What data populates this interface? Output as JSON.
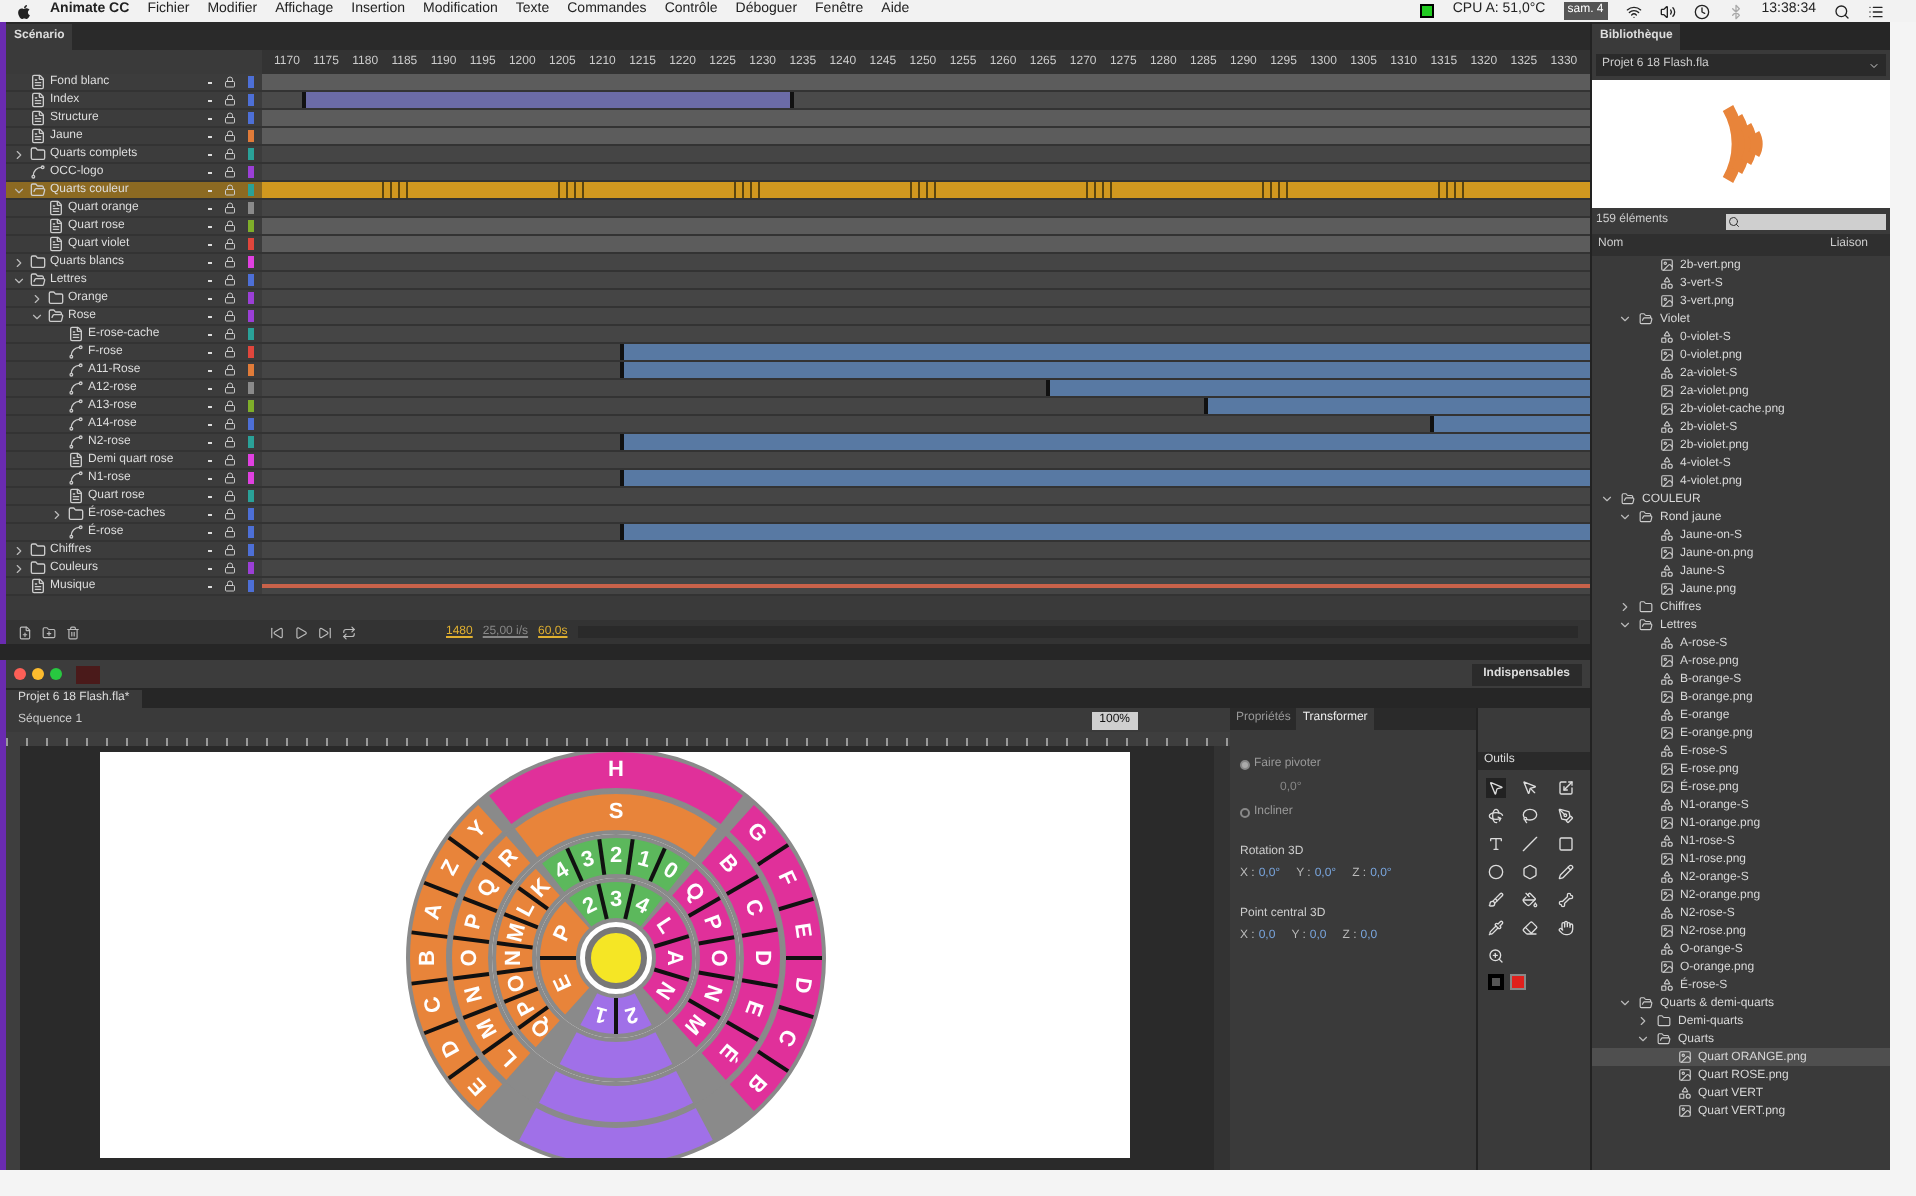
{
  "menubar": {
    "app": "Animate CC",
    "menus": [
      "Fichier",
      "Modifier",
      "Affichage",
      "Insertion",
      "Modification",
      "Texte",
      "Commandes",
      "Contrôle",
      "Déboguer",
      "Fenêtre",
      "Aide"
    ],
    "cpu": "CPU A: 51,0°C",
    "date": "sam. 4",
    "time": "13:38:34"
  },
  "timeline": {
    "tab": "Scénario",
    "frames": [
      "1170",
      "1175",
      "1180",
      "1185",
      "1190",
      "1195",
      "1200",
      "1205",
      "1210",
      "1215",
      "1220",
      "1225",
      "1230",
      "1235",
      "1240",
      "1245",
      "1250",
      "1255",
      "1260",
      "1265",
      "1270",
      "1275",
      "1280",
      "1285",
      "1290",
      "1295",
      "1300",
      "1305",
      "1310",
      "1315",
      "1320",
      "1325",
      "1330"
    ],
    "layers": [
      {
        "name": "Fond blanc",
        "kind": "layer",
        "selected": false,
        "color": "#4d6fd6",
        "frames": {
          "kind": "gray"
        }
      },
      {
        "name": "Index",
        "kind": "layer",
        "selected": false,
        "color": "#4d6fd6",
        "frames": {
          "kind": "index"
        }
      },
      {
        "name": "Structure",
        "kind": "layer",
        "selected": false,
        "color": "#4d6fd6",
        "frames": {
          "kind": "gray"
        }
      },
      {
        "name": "Jaune",
        "kind": "layer",
        "selected": false,
        "color": "#e07b39",
        "frames": {
          "kind": "gray"
        }
      },
      {
        "name": "Quarts complets",
        "kind": "folder",
        "expanded": false,
        "selected": false,
        "color": "#2aa198",
        "frames": {
          "kind": "empty"
        }
      },
      {
        "name": "OCC-logo",
        "kind": "guide",
        "selected": false,
        "color": "#9b3fd6",
        "frames": {
          "kind": "empty"
        }
      },
      {
        "name": "Quarts couleur",
        "kind": "folder",
        "expanded": true,
        "selected": true,
        "color": "#2aa198",
        "frames": {
          "kind": "active"
        },
        "children": [
          {
            "name": "Quart orange",
            "kind": "layer",
            "selected": false,
            "color": "#8a8a8a",
            "frames": {
              "kind": "empty"
            }
          },
          {
            "name": "Quart rose",
            "kind": "layer",
            "selected": false,
            "color": "#7fae2a",
            "frames": {
              "kind": "gray"
            }
          },
          {
            "name": "Quart violet",
            "kind": "layer",
            "selected": false,
            "color": "#e0463c",
            "frames": {
              "kind": "gray"
            }
          }
        ]
      },
      {
        "name": "Quarts blancs",
        "kind": "folder",
        "expanded": false,
        "selected": false,
        "color": "#e040e0",
        "frames": {
          "kind": "empty"
        }
      },
      {
        "name": "Lettres",
        "kind": "folder",
        "expanded": true,
        "selected": false,
        "color": "#4d6fd6",
        "frames": {
          "kind": "empty"
        },
        "children": [
          {
            "name": "Orange",
            "kind": "folder",
            "expanded": false,
            "selected": false,
            "color": "#9b3fd6",
            "frames": {
              "kind": "empty"
            }
          },
          {
            "name": "Rose",
            "kind": "folder",
            "expanded": true,
            "selected": false,
            "color": "#9b3fd6",
            "frames": {
              "kind": "empty"
            },
            "children": [
              {
                "name": "E-rose-cache",
                "kind": "layer",
                "selected": false,
                "color": "#2aa198",
                "frames": {
                  "kind": "empty"
                }
              },
              {
                "name": "F-rose",
                "kind": "guide",
                "selected": false,
                "color": "#e0463c",
                "frames": {
                  "kind": "tween",
                  "level": 0.73
                }
              },
              {
                "name": "A11-Rose",
                "kind": "guide",
                "selected": false,
                "color": "#e07b39",
                "frames": {
                  "kind": "tween",
                  "level": 0.73
                }
              },
              {
                "name": "A12-rose",
                "kind": "guide",
                "selected": false,
                "color": "#8a8a8a",
                "frames": {
                  "kind": "tween",
                  "level": 0.41
                }
              },
              {
                "name": "A13-rose",
                "kind": "guide",
                "selected": false,
                "color": "#7fae2a",
                "frames": {
                  "kind": "tween",
                  "level": 0.29
                }
              },
              {
                "name": "A14-rose",
                "kind": "guide",
                "selected": false,
                "color": "#4d6fd6",
                "frames": {
                  "kind": "tween",
                  "level": 0.12
                }
              },
              {
                "name": "N2-rose",
                "kind": "guide",
                "selected": false,
                "color": "#2aa198",
                "frames": {
                  "kind": "tween",
                  "level": 0.73
                }
              },
              {
                "name": "Demi quart rose",
                "kind": "layer",
                "selected": false,
                "color": "#e040e0",
                "frames": {
                  "kind": "empty"
                }
              },
              {
                "name": "N1-rose",
                "kind": "guide",
                "selected": false,
                "color": "#e040e0",
                "frames": {
                  "kind": "tween",
                  "level": 0.73
                }
              },
              {
                "name": "Quart rose",
                "kind": "layer",
                "selected": false,
                "color": "#2aa198",
                "frames": {
                  "kind": "empty"
                }
              },
              {
                "name": "É-rose-caches",
                "kind": "folder",
                "expanded": false,
                "selected": false,
                "color": "#4d6fd6",
                "frames": {
                  "kind": "empty"
                }
              },
              {
                "name": "É-rose",
                "kind": "guide",
                "selected": false,
                "color": "#4d6fd6",
                "frames": {
                  "kind": "tween",
                  "level": 0.73
                }
              }
            ]
          }
        ]
      },
      {
        "name": "Chiffres",
        "kind": "folder",
        "expanded": false,
        "selected": false,
        "color": "#4d6fd6",
        "frames": {
          "kind": "empty"
        }
      },
      {
        "name": "Couleurs",
        "kind": "folder",
        "expanded": false,
        "selected": false,
        "color": "#9b3fd6",
        "frames": {
          "kind": "empty"
        }
      },
      {
        "name": "Musique",
        "kind": "layer",
        "selected": false,
        "color": "#4d6fd6",
        "frames": {
          "kind": "audio"
        }
      }
    ],
    "frame": "1480",
    "fps": "25,00 i/s",
    "elapsed": "60,0s"
  },
  "document": {
    "workspace": "Indispensables",
    "tab": "Projet 6 18 Flash.fla*",
    "scene": "Séquence 1",
    "zoom": "100%",
    "wheel": {
      "rings": [
        {
          "segments": [
            {
              "color": "#e8843a",
              "labels": [
                "E",
                "P"
              ]
            },
            {
              "color": "#5cb85c",
              "labels": [
                "2",
                "3",
                "4"
              ]
            },
            {
              "color": "#e0309a",
              "labels": [
                "L",
                "A",
                "N"
              ]
            },
            {
              "color": "#a070e8",
              "labels": [
                "2",
                "1"
              ]
            }
          ]
        },
        {
          "segments": [
            {
              "color": "#e8843a",
              "labels": [
                "Q",
                "P",
                "O",
                "N",
                "M",
                "L",
                "K"
              ]
            },
            {
              "color": "#5cb85c",
              "labels": [
                "4",
                "3",
                "2",
                "1",
                "0"
              ]
            },
            {
              "color": "#e0309a",
              "labels": [
                "Q",
                "P",
                "O",
                "N",
                "M"
              ]
            },
            {
              "color": "#a070e8"
            }
          ]
        },
        {
          "segments": [
            {
              "color": "#e8843a",
              "labels": [
                "L",
                "M",
                "N",
                "O",
                "P",
                "Q",
                "R"
              ]
            },
            {
              "color": "#e8843a",
              "labels": [
                "S"
              ]
            },
            {
              "color": "#e0309a",
              "labels": [
                "B",
                "C",
                "D",
                "E",
                "É"
              ]
            },
            {
              "color": "#a070e8"
            }
          ]
        },
        {
          "segments": [
            {
              "color": "#e8843a",
              "labels": [
                "E",
                "D",
                "C",
                "B",
                "A",
                "Z",
                "Y"
              ]
            },
            {
              "color": "#e0309a",
              "labels": [
                "H"
              ]
            },
            {
              "color": "#e0309a",
              "labels": [
                "G",
                "F",
                "E",
                "D",
                "C",
                "B"
              ]
            },
            {
              "color": "#a070e8"
            }
          ]
        }
      ]
    }
  },
  "properties": {
    "tabs": [
      {
        "label": "Propriétés",
        "selected": false
      },
      {
        "label": "Transformer",
        "selected": true
      }
    ],
    "rotate": {
      "label": "Faire pivoter",
      "value": "0,0°",
      "selected": true
    },
    "skew": {
      "label": "Incliner",
      "selected": false
    },
    "rotation3d": {
      "title": "Rotation 3D",
      "fields": [
        {
          "label": "X :",
          "value": "0,0°"
        },
        {
          "label": "Y :",
          "value": "0,0°"
        },
        {
          "label": "Z :",
          "value": "0,0°"
        }
      ]
    },
    "center3d": {
      "title": "Point central 3D",
      "fields": [
        {
          "label": "X :",
          "value": "0,0"
        },
        {
          "label": "Y :",
          "value": "0,0"
        },
        {
          "label": "Z :",
          "value": "0,0"
        }
      ]
    }
  },
  "tools": {
    "title": "Outils",
    "items": [
      {
        "kind": "select",
        "selected": true
      },
      {
        "kind": "subselect",
        "selected": false
      },
      {
        "kind": "transform",
        "selected": false
      },
      {
        "kind": "rotate3d",
        "selected": false
      },
      {
        "kind": "lasso",
        "selected": false
      },
      {
        "kind": "pen",
        "selected": false
      },
      {
        "kind": "text",
        "selected": false
      },
      {
        "kind": "line",
        "selected": false
      },
      {
        "kind": "rect",
        "selected": false
      },
      {
        "kind": "oval",
        "selected": false
      },
      {
        "kind": "poly",
        "selected": false
      },
      {
        "kind": "pencil",
        "selected": false
      },
      {
        "kind": "brush",
        "selected": false
      },
      {
        "kind": "bucket",
        "selected": false
      },
      {
        "kind": "bone",
        "selected": false
      },
      {
        "kind": "eyedropper",
        "selected": false
      },
      {
        "kind": "eraser",
        "selected": false
      },
      {
        "kind": "hand",
        "selected": false
      },
      {
        "kind": "zoom",
        "selected": false
      }
    ],
    "swatches": [
      {
        "kind": "stroke",
        "color": "#000000"
      },
      {
        "kind": "fill",
        "color": "#e0201c"
      }
    ]
  },
  "library": {
    "title": "Bibliothèque",
    "document": "Projet 6 18 Flash.fla",
    "count": "159 éléments",
    "columns": [
      "Nom",
      "Liaison"
    ],
    "items": [
      {
        "kind": "group",
        "children": [
          {
            "kind": "group",
            "children": [
              {
                "name": "2b-vert.png",
                "kind": "bitmap",
                "selected": false
              },
              {
                "name": "3-vert-S",
                "kind": "symbol",
                "selected": false
              },
              {
                "name": "3-vert.png",
                "kind": "bitmap",
                "selected": false
              }
            ]
          },
          {
            "name": "Violet",
            "kind": "folder",
            "expanded": true,
            "selected": false,
            "children": [
              {
                "name": "0-violet-S",
                "kind": "symbol",
                "selected": false
              },
              {
                "name": "0-violet.png",
                "kind": "bitmap",
                "selected": false
              },
              {
                "name": "2a-violet-S",
                "kind": "symbol",
                "selected": false
              },
              {
                "name": "2a-violet.png",
                "kind": "bitmap",
                "selected": false
              },
              {
                "name": "2b-violet-cache.png",
                "kind": "bitmap",
                "selected": false
              },
              {
                "name": "2b-violet-S",
                "kind": "symbol",
                "selected": false
              },
              {
                "name": "2b-violet.png",
                "kind": "bitmap",
                "selected": false
              },
              {
                "name": "4-violet-S",
                "kind": "symbol",
                "selected": false
              },
              {
                "name": "4-violet.png",
                "kind": "bitmap",
                "selected": false
              }
            ]
          }
        ]
      },
      {
        "name": "COULEUR",
        "kind": "folder",
        "expanded": true,
        "selected": false,
        "children": [
          {
            "name": "Rond jaune",
            "kind": "folder",
            "expanded": true,
            "selected": false,
            "children": [
              {
                "name": "Jaune-on-S",
                "kind": "symbol",
                "selected": false
              },
              {
                "name": "Jaune-on.png",
                "kind": "bitmap",
                "selected": false
              },
              {
                "name": "Jaune-S",
                "kind": "symbol",
                "selected": false
              },
              {
                "name": "Jaune.png",
                "kind": "bitmap",
                "selected": false
              }
            ]
          },
          {
            "name": "Chiffres",
            "kind": "folder",
            "expanded": false,
            "selected": false
          },
          {
            "name": "Lettres",
            "kind": "folder",
            "expanded": true,
            "selected": false,
            "children": [
              {
                "name": "A-rose-S",
                "kind": "symbol",
                "selected": false
              },
              {
                "name": "A-rose.png",
                "kind": "bitmap",
                "selected": false
              },
              {
                "name": "B-orange-S",
                "kind": "symbol",
                "selected": false
              },
              {
                "name": "B-orange.png",
                "kind": "bitmap",
                "selected": false
              },
              {
                "name": "E-orange",
                "kind": "symbol",
                "selected": false
              },
              {
                "name": "E-orange.png",
                "kind": "bitmap",
                "selected": false
              },
              {
                "name": "E-rose-S",
                "kind": "symbol",
                "selected": false
              },
              {
                "name": "E-rose.png",
                "kind": "bitmap",
                "selected": false
              },
              {
                "name": "É-rose.png",
                "kind": "bitmap",
                "selected": false
              },
              {
                "name": "N1-orange-S",
                "kind": "symbol",
                "selected": false
              },
              {
                "name": "N1-orange.png",
                "kind": "bitmap",
                "selected": false
              },
              {
                "name": "N1-rose-S",
                "kind": "symbol",
                "selected": false
              },
              {
                "name": "N1-rose.png",
                "kind": "bitmap",
                "selected": false
              },
              {
                "name": "N2-orange-S",
                "kind": "symbol",
                "selected": false
              },
              {
                "name": "N2-orange.png",
                "kind": "bitmap",
                "selected": false
              },
              {
                "name": "N2-rose-S",
                "kind": "symbol",
                "selected": false
              },
              {
                "name": "N2-rose.png",
                "kind": "bitmap",
                "selected": false
              },
              {
                "name": "O-orange-S",
                "kind": "symbol",
                "selected": false
              },
              {
                "name": "O-orange.png",
                "kind": "bitmap",
                "selected": false
              },
              {
                "name": "É-rose-S",
                "kind": "symbol",
                "selected": false
              }
            ]
          },
          {
            "name": "Quarts & demi-quarts",
            "kind": "folder",
            "expanded": true,
            "selected": false,
            "children": [
              {
                "name": "Demi-quarts",
                "kind": "folder",
                "expanded": false,
                "selected": false
              },
              {
                "name": "Quarts",
                "kind": "folder",
                "expanded": true,
                "selected": false,
                "children": [
                  {
                    "name": "Quart ORANGE.png",
                    "kind": "bitmap",
                    "selected": true
                  },
                  {
                    "name": "Quart ROSE.png",
                    "kind": "bitmap",
                    "selected": false
                  },
                  {
                    "name": "Quart VERT",
                    "kind": "symbol",
                    "selected": false
                  },
                  {
                    "name": "Quart VERT.png",
                    "kind": "bitmap",
                    "selected": false
                  }
                ]
              }
            ]
          }
        ]
      }
    ]
  }
}
